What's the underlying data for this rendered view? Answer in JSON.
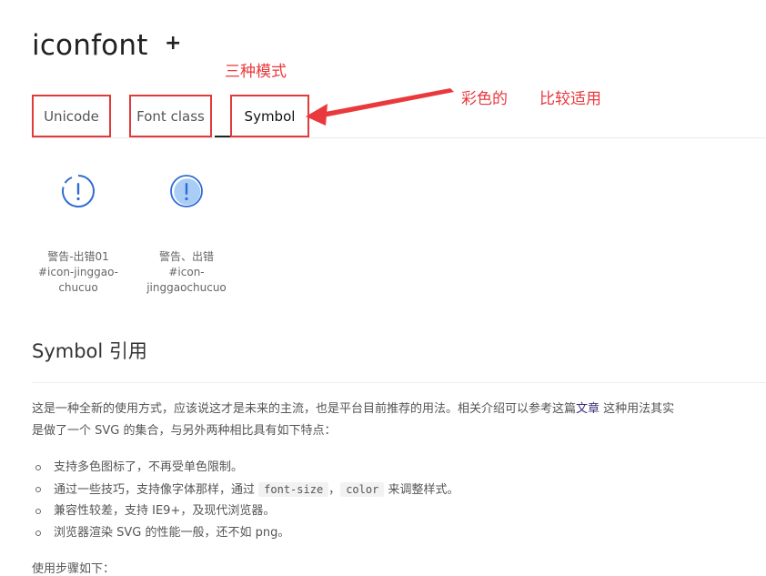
{
  "logo": {
    "text": "iconfont",
    "plus": "+"
  },
  "annotations": {
    "modes": "三种模式",
    "colorful": "彩色的",
    "suitable": "比较适用",
    "color": "#e9393d"
  },
  "tabs": [
    {
      "label": "Unicode",
      "active": false
    },
    {
      "label": "Font class",
      "active": false
    },
    {
      "label": "Symbol",
      "active": true
    }
  ],
  "icons": [
    {
      "name": "警告-出错01",
      "code": "#icon-jinggao-chucuo",
      "code_line1": "#icon-jinggao-",
      "code_line2": "chucuo",
      "glyph": "warning-outline-icon"
    },
    {
      "name": "警告、出错",
      "code": "#icon-jinggaochucuo",
      "code_line1": "#icon-",
      "code_line2": "jinggaochucuo",
      "glyph": "warning-filled-icon"
    }
  ],
  "section": {
    "title": "Symbol 引用",
    "intro_before_link": "这是一种全新的使用方式，应该说这才是未来的主流，也是平台目前推荐的用法。相关介绍可以参考这篇",
    "intro_link": "文章",
    "intro_after_link": " 这种用法其实",
    "intro_line2": "是做了一个 SVG 的集合，与另外两种相比具有如下特点：",
    "features": {
      "f1": "支持多色图标了，不再受单色限制。",
      "f2_before": "通过一些技巧，支持像字体那样，通过 ",
      "f2_code1": "font-size",
      "f2_mid": "，",
      "f2_code2": "color",
      "f2_after": " 来调整样式。",
      "f3": "兼容性较差，支持 IE9+，及现代浏览器。",
      "f4": "浏览器渲染 SVG 的性能一般，还不如 png。"
    },
    "cut_text": "使用步骤如下："
  },
  "colors": {
    "annotation_red": "#e9393d",
    "icon_blue": "#2f6bd6",
    "icon_fill": "#a9cdf5"
  }
}
